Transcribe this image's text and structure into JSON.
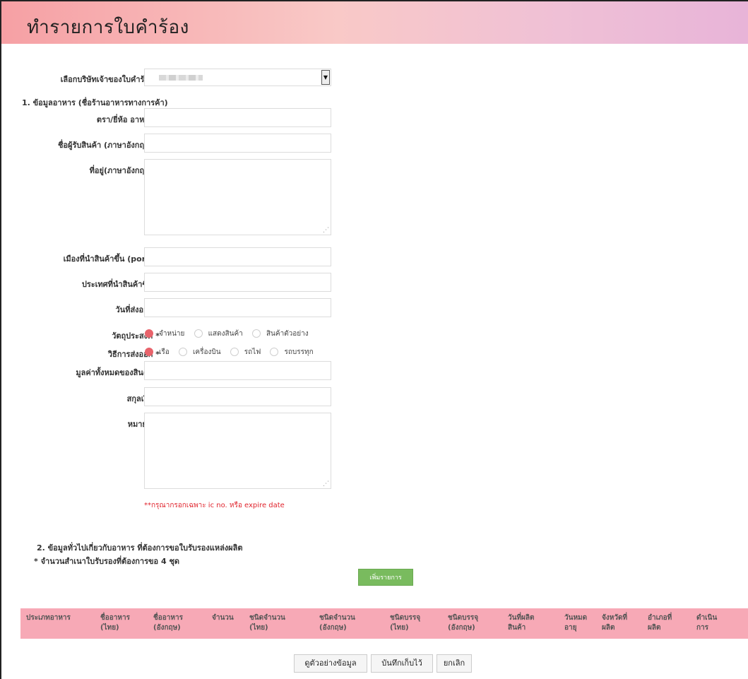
{
  "page": {
    "title": "ทำรายการใบคำร้อง"
  },
  "form": {
    "company_select": {
      "label": "เลือกบริษัทเจ้าของใบคำร้อง *"
    },
    "section1_title": "1. ข้อมูลอาหาร (ชื่อร้านอาหารทางการค้า)",
    "brand_label": "ตรา/ยี่ห้อ อาหาร *",
    "consignee_label": "ชื่อผู้รับสินค้า (ภาษาอังกฤษ) *",
    "address_label": "ที่อยู่(ภาษาอังกฤษ) *",
    "port_label": "เมืองที่นำสินค้าขึ้น (port) *",
    "country_label": "ประเทศที่นำสินค้าขึ้น *",
    "ship_date_label": "วันที่ส่งออก *",
    "purpose": {
      "label": "วัตถุประสงค์ *",
      "options": [
        "จำหน่าย",
        "แสดงสินค้า",
        "สินค้าตัวอย่าง"
      ],
      "selected": "จำหน่าย"
    },
    "shipping_method": {
      "label": "วิธีการส่งออก *",
      "options": [
        "เรือ",
        "เครื่องบิน",
        "รถไฟ",
        "รถบรรทุก"
      ],
      "selected": "เรือ"
    },
    "total_value_label": "มูลค่าทั้งหมดของสินค้า *",
    "currency_label": "สกุลเงิน *",
    "remark_label": "หมายเหตุ",
    "remark_note": "**กรุณากรอกเฉพาะ ic no. หรือ expire date"
  },
  "section2": {
    "title": "2. ข้อมูลทั่วไปเกี่ยวกับอาหาร ที่ต้องการขอใบรับรองแหล่งผลิต",
    "copies_note": "* จำนวนสำเนาใบรับรองที่ต้องการขอ 4 ชุด",
    "add_button": "เพิ่มรายการ"
  },
  "table": {
    "columns": [
      [
        "ประเภทอาหาร"
      ],
      [
        "ชื่ออาหาร",
        "(ไทย)"
      ],
      [
        "ชื่ออาหาร",
        "(อังกฤษ)"
      ],
      [
        "จำนวน"
      ],
      [
        "ชนิดจำนวน",
        "(ไทย)"
      ],
      [
        "ชนิดจำนวน",
        "(อังกฤษ)"
      ],
      [
        "ชนิดบรรจุ",
        "(ไทย)"
      ],
      [
        "ชนิดบรรจุ",
        "(อังกฤษ)"
      ],
      [
        "วันที่ผลิต",
        "สินค้า"
      ],
      [
        "วันหมด",
        "อายุ"
      ],
      [
        "จังหวัดที่",
        "ผลิต"
      ],
      [
        "อำเภอที่",
        "ผลิต"
      ],
      [
        "ดำเนิน",
        "การ"
      ]
    ]
  },
  "actions": {
    "preview": "ดูตัวอย่างข้อมูล",
    "save": "บันทึกเก็บไว้",
    "cancel": "ยกเลิก"
  },
  "colors": {
    "radio_selected": "#e8636b",
    "add_button": "#79bb5e",
    "table_header": "#f7a9b6",
    "note_red": "#e0242d"
  }
}
